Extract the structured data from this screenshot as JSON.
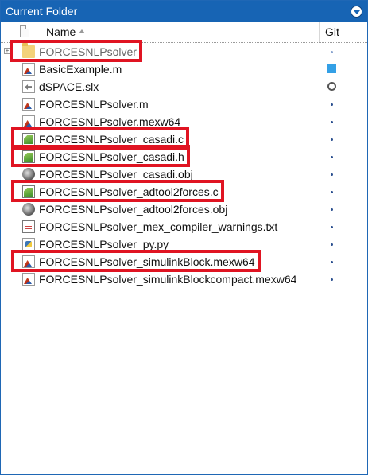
{
  "panel": {
    "title": "Current Folder",
    "toggle_icon": "chevron-down-icon"
  },
  "columns": {
    "name": "Name",
    "git": "Git",
    "sort": "ascending"
  },
  "rows": [
    {
      "name": "FORCESNLPsolver",
      "icon": "folder-icon",
      "git": "dot-faint",
      "expander": "+",
      "highlighted": true,
      "muted": true
    },
    {
      "name": "BasicExample.m",
      "icon": "matlab-file-icon",
      "git": "square",
      "highlighted": false
    },
    {
      "name": "dSPACE.slx",
      "icon": "simulink-model-icon",
      "git": "circle",
      "highlighted": false
    },
    {
      "name": "FORCESNLPsolver.m",
      "icon": "matlab-file-icon",
      "git": "dot",
      "highlighted": false
    },
    {
      "name": "FORCESNLPsolver.mexw64",
      "icon": "mex-file-icon",
      "git": "dot",
      "highlighted": false
    },
    {
      "name": "FORCESNLPsolver_casadi.c",
      "icon": "c-source-icon",
      "git": "dot",
      "highlighted": true
    },
    {
      "name": "FORCESNLPsolver_casadi.h",
      "icon": "c-header-icon",
      "git": "dot",
      "highlighted": true
    },
    {
      "name": "FORCESNLPsolver_casadi.obj",
      "icon": "object-file-icon",
      "git": "dot",
      "highlighted": false
    },
    {
      "name": "FORCESNLPsolver_adtool2forces.c",
      "icon": "c-source-icon",
      "git": "dot",
      "highlighted": true
    },
    {
      "name": "FORCESNLPsolver_adtool2forces.obj",
      "icon": "object-file-icon",
      "git": "dot",
      "highlighted": false
    },
    {
      "name": "FORCESNLPsolver_mex_compiler_warnings.txt",
      "icon": "text-file-icon",
      "git": "dot",
      "highlighted": false
    },
    {
      "name": "FORCESNLPsolver_py.py",
      "icon": "python-file-icon",
      "git": "dot",
      "highlighted": false
    },
    {
      "name": "FORCESNLPsolver_simulinkBlock.mexw64",
      "icon": "matlab-file-icon",
      "git": "dot",
      "highlighted": true
    },
    {
      "name": "FORCESNLPsolver_simulinkBlockcompact.mexw64",
      "icon": "matlab-file-icon",
      "git": "dot",
      "highlighted": false
    }
  ],
  "colors": {
    "titlebar": "#1764b4",
    "highlight": "#e01422",
    "git_added": "#33a0e6"
  }
}
